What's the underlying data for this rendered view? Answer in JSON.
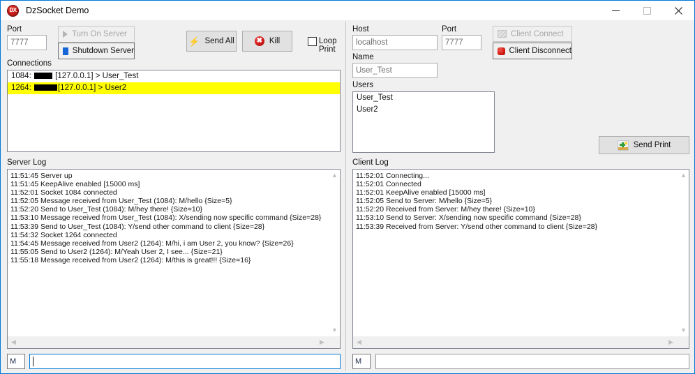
{
  "window": {
    "title": "DzSocket Demo",
    "icon_label": "DX",
    "accent_color": "#0078d7",
    "caption": {
      "minimize": "minimize-icon",
      "maximize": "maximize-icon",
      "close": "close-icon"
    }
  },
  "server": {
    "port_label": "Port",
    "port_value": "7777",
    "turn_on_label": "Turn On Server",
    "shutdown_label": "Shutdown Server",
    "send_all_label": "Send All",
    "kill_label": "Kill",
    "loop_print_label_1": "Loop",
    "loop_print_label_2": "Print",
    "loop_print_checked": false,
    "connections_label": "Connections",
    "connections": [
      {
        "prefix": "1084: ",
        "redacted_width": 26,
        "suffix": " [127.0.0.1] > User_Test",
        "selected": false
      },
      {
        "prefix": "1264: ",
        "redacted_width": 33,
        "suffix": "[127.0.0.1] > User2",
        "selected": true
      }
    ],
    "log_label": "Server Log",
    "log_lines": [
      "11:51:45 Server up",
      "11:51:45 KeepAlive enabled [15000 ms]",
      "11:52:01 Socket 1084 connected",
      "11:52:05 Message received from User_Test (1084): M/hello {Size=5}",
      "11:52:20 Send to User_Test (1084): M/hey there! {Size=10}",
      "11:53:10 Message received from User_Test (1084): X/sending now specific command {Size=28}",
      "11:53:39 Send to User_Test (1084): Y/send other command to client {Size=28}",
      "11:54:32 Socket 1264 connected",
      "11:54:45 Message received from User2 (1264): M/hi, i am User 2, you know? {Size=26}",
      "11:55:05 Send to User2 (1264): M/Yeah User 2, I see... {Size=21}",
      "11:55:18 Message received from User2 (1264): M/this is great!!! {Size=16}"
    ],
    "msg_kind": "M",
    "msg_value": "",
    "msg_focused": true
  },
  "client": {
    "host_label": "Host",
    "host_value": "localhost",
    "port_label": "Port",
    "port_value": "7777",
    "name_label": "Name",
    "name_value": "User_Test",
    "connect_label": "Client Connect",
    "disconnect_label": "Client Disconnect",
    "users_label": "Users",
    "users": [
      "User_Test",
      "User2"
    ],
    "send_print_label": "Send Print",
    "log_label": "Client Log",
    "log_lines": [
      "11:52:01 Connecting...",
      "11:52:01 Connected",
      "11:52:01 KeepAlive enabled [15000 ms]",
      "11:52:05 Send to Server: M/hello {Size=5}",
      "11:52:20 Received from Server: M/hey there! {Size=10}",
      "11:53:10 Send to Server: X/sending now specific command {Size=28}",
      "11:53:39 Received from Server: Y/send other command to client {Size=28}"
    ],
    "msg_kind": "M",
    "msg_value": "",
    "msg_focused": false
  },
  "scroll": {
    "up": "▲",
    "down": "▼",
    "left": "◀",
    "right": "▶"
  }
}
